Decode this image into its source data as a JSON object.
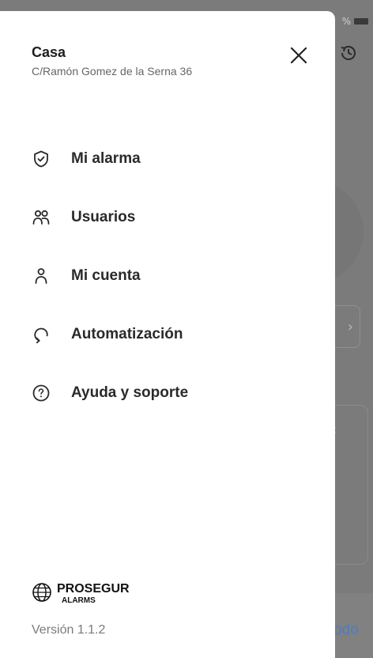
{
  "background": {
    "status_percent": "%",
    "footer_text": "odo",
    "icons": [
      "history-icon",
      "chevron-right-icon",
      "chevron-left-icon",
      "battery-icon"
    ]
  },
  "drawer": {
    "home": {
      "title": "Casa",
      "address": "C/Ramón Gomez de la Serna 36"
    },
    "close_icon": "close-icon",
    "menu": [
      {
        "label": "Mi alarma",
        "icon": "shield-check-icon"
      },
      {
        "label": "Usuarios",
        "icon": "users-icon"
      },
      {
        "label": "Mi cuenta",
        "icon": "user-icon"
      },
      {
        "label": "Automatización",
        "icon": "automation-icon"
      },
      {
        "label": "Ayuda y soporte",
        "icon": "help-icon"
      }
    ],
    "brand": {
      "name": "PROSEGUR",
      "sub": "ALARMS",
      "icon": "globe-logo-icon"
    },
    "version": "Versión 1.1.2"
  },
  "colors": {
    "drawer_bg": "#ffffff",
    "overlay": "#7b7b7b",
    "text_primary": "#2a2a2a",
    "text_secondary": "#666666",
    "link_blue": "#4e7cc0"
  }
}
